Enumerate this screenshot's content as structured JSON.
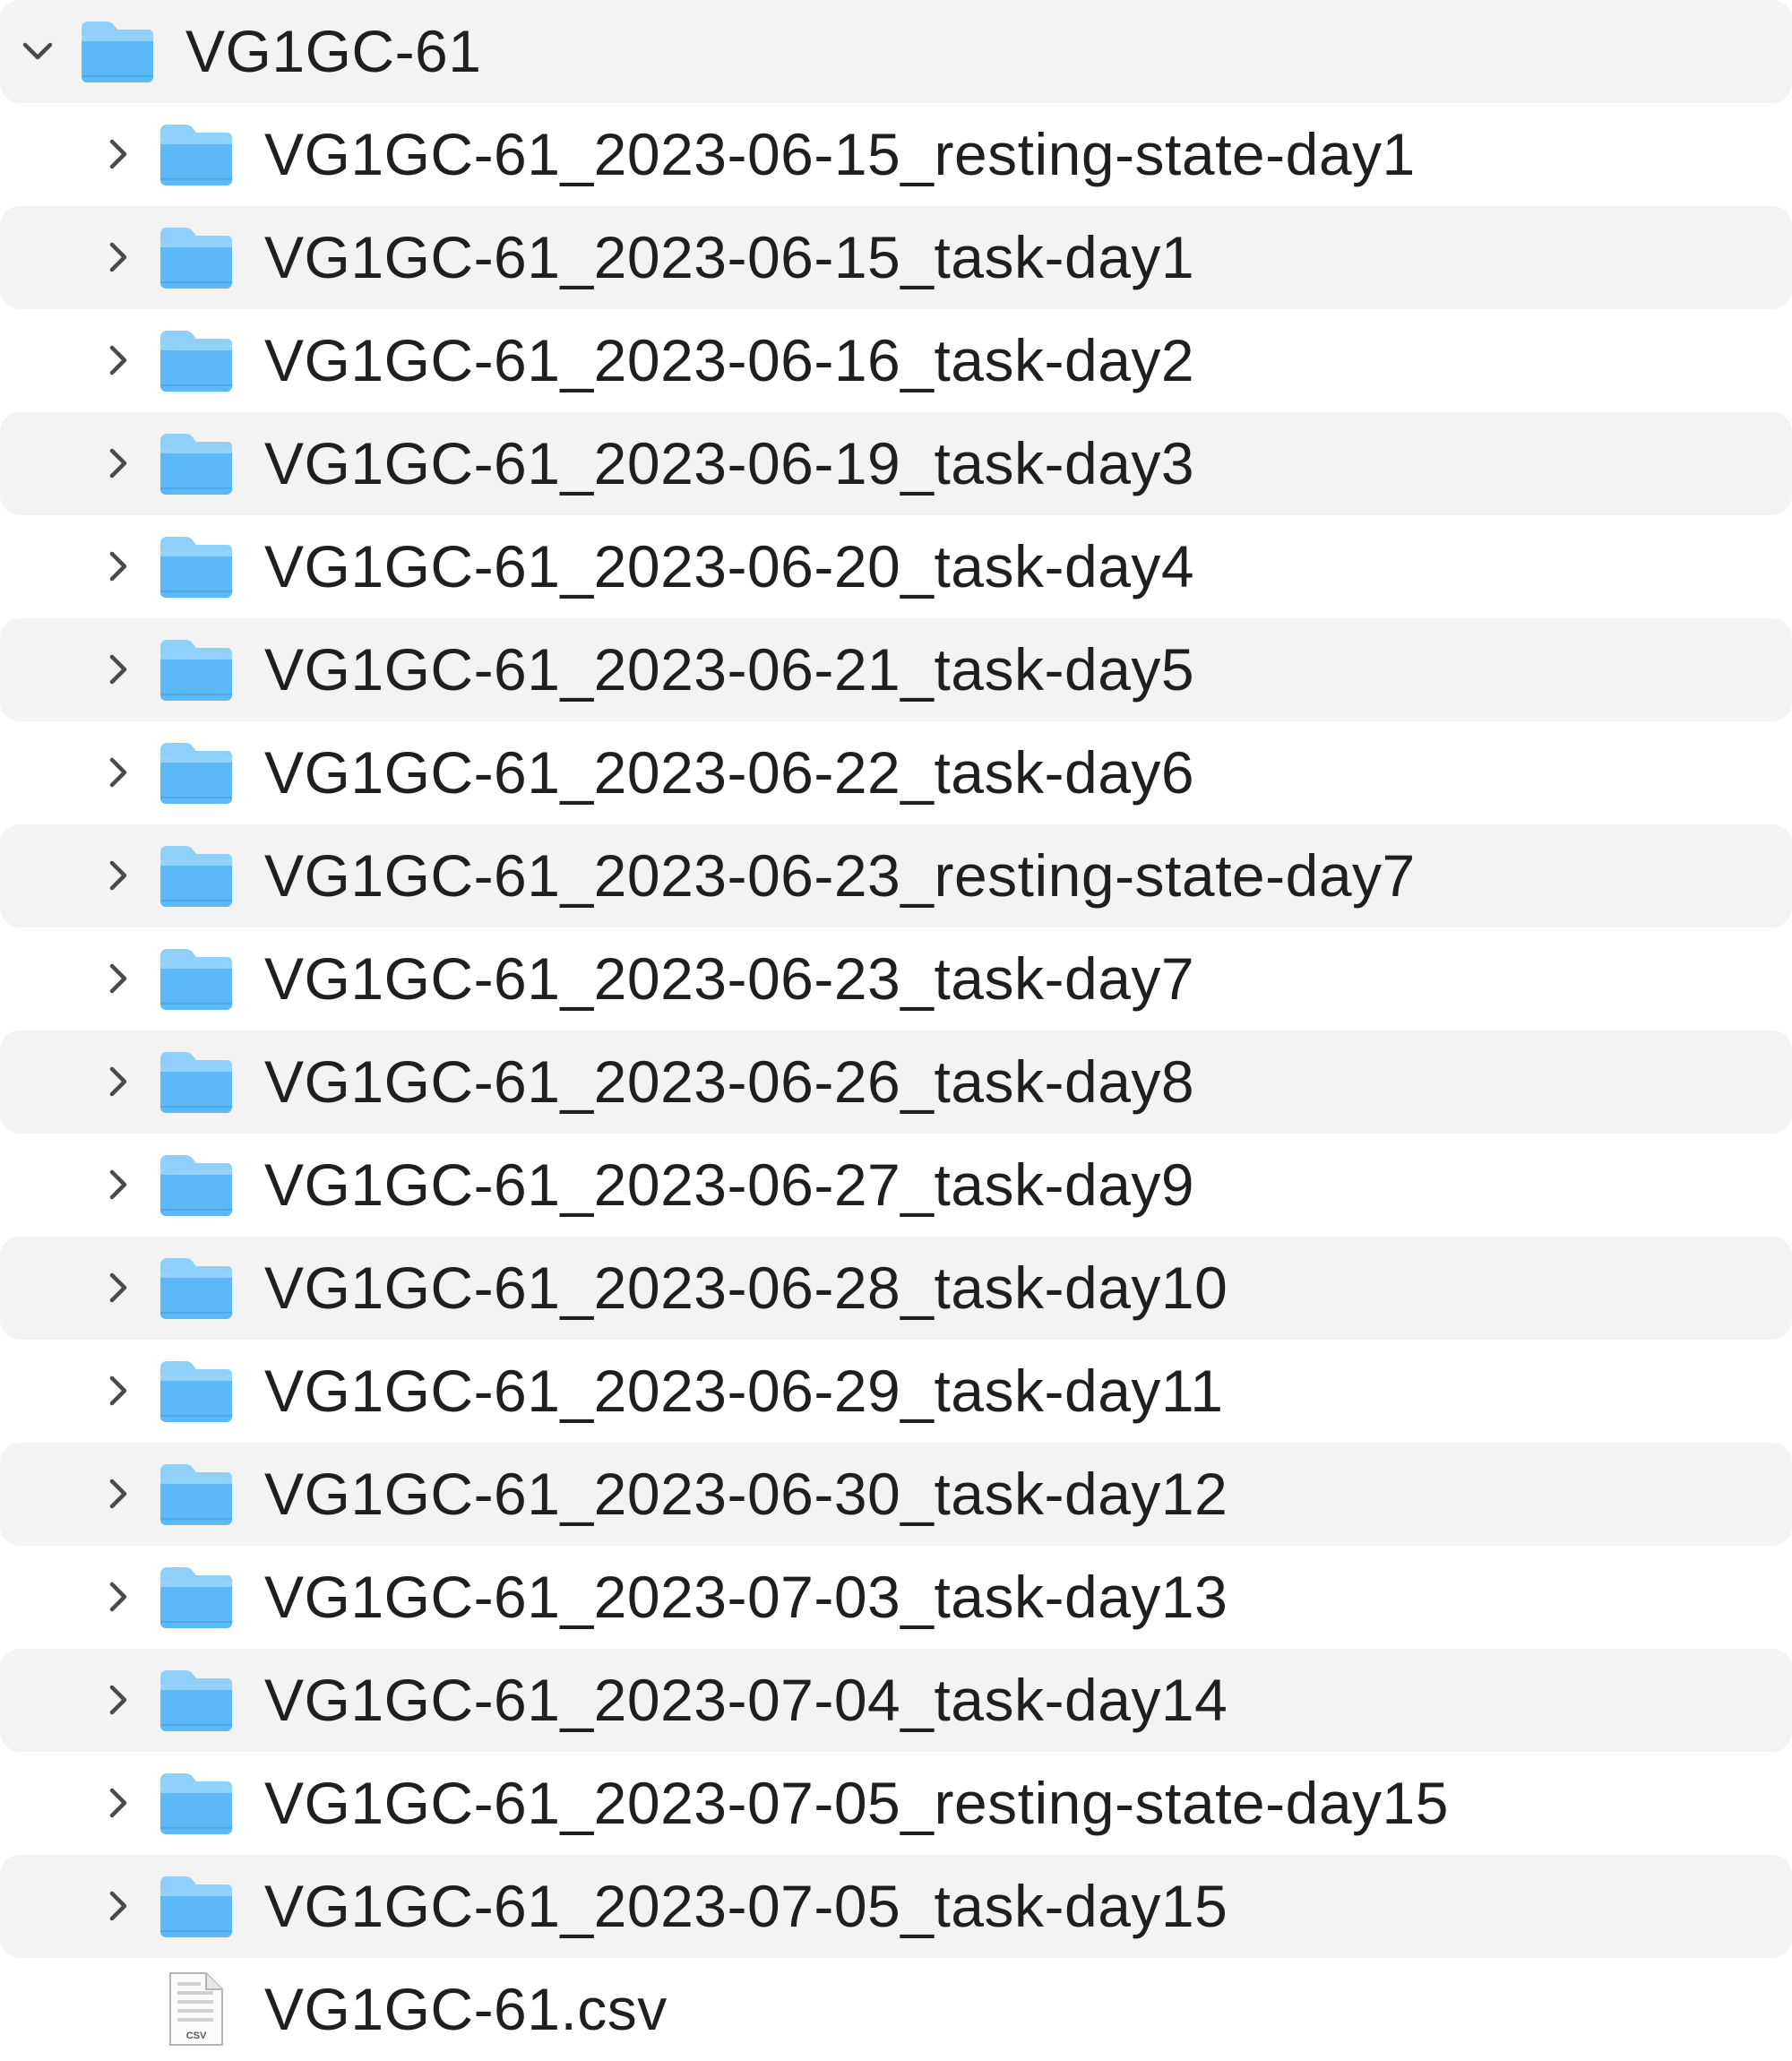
{
  "root": {
    "name": "VG1GC-61",
    "expanded": true,
    "icon": "folder-icon"
  },
  "children": [
    {
      "name": "VG1GC-61_2023-06-15_resting-state-day1",
      "type": "folder",
      "icon": "folder-icon"
    },
    {
      "name": "VG1GC-61_2023-06-15_task-day1",
      "type": "folder",
      "icon": "folder-icon"
    },
    {
      "name": "VG1GC-61_2023-06-16_task-day2",
      "type": "folder",
      "icon": "folder-icon"
    },
    {
      "name": "VG1GC-61_2023-06-19_task-day3",
      "type": "folder",
      "icon": "folder-icon"
    },
    {
      "name": "VG1GC-61_2023-06-20_task-day4",
      "type": "folder",
      "icon": "folder-icon"
    },
    {
      "name": "VG1GC-61_2023-06-21_task-day5",
      "type": "folder",
      "icon": "folder-icon"
    },
    {
      "name": "VG1GC-61_2023-06-22_task-day6",
      "type": "folder",
      "icon": "folder-icon"
    },
    {
      "name": "VG1GC-61_2023-06-23_resting-state-day7",
      "type": "folder",
      "icon": "folder-icon"
    },
    {
      "name": "VG1GC-61_2023-06-23_task-day7",
      "type": "folder",
      "icon": "folder-icon"
    },
    {
      "name": "VG1GC-61_2023-06-26_task-day8",
      "type": "folder",
      "icon": "folder-icon"
    },
    {
      "name": "VG1GC-61_2023-06-27_task-day9",
      "type": "folder",
      "icon": "folder-icon"
    },
    {
      "name": "VG1GC-61_2023-06-28_task-day10",
      "type": "folder",
      "icon": "folder-icon"
    },
    {
      "name": "VG1GC-61_2023-06-29_task-day11",
      "type": "folder",
      "icon": "folder-icon"
    },
    {
      "name": "VG1GC-61_2023-06-30_task-day12",
      "type": "folder",
      "icon": "folder-icon"
    },
    {
      "name": "VG1GC-61_2023-07-03_task-day13",
      "type": "folder",
      "icon": "folder-icon"
    },
    {
      "name": "VG1GC-61_2023-07-04_task-day14",
      "type": "folder",
      "icon": "folder-icon"
    },
    {
      "name": "VG1GC-61_2023-07-05_resting-state-day15",
      "type": "folder",
      "icon": "folder-icon"
    },
    {
      "name": "VG1GC-61_2023-07-05_task-day15",
      "type": "folder",
      "icon": "folder-icon"
    },
    {
      "name": "VG1GC-61.csv",
      "type": "file",
      "icon": "csv-file-icon",
      "icon_badge": "CSV"
    }
  ],
  "colors": {
    "stripe": "#f3f3f3",
    "folder_top": "#8fd0fb",
    "folder_body": "#5cb9f6",
    "chevron": "#4a4a4a"
  }
}
